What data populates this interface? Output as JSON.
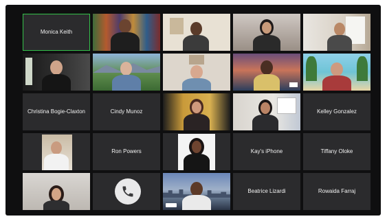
{
  "meeting": {
    "tiles": [
      {
        "label": "Monica Keith",
        "type": "name",
        "active": true
      },
      {
        "label": "",
        "type": "video",
        "scene": "mural"
      },
      {
        "label": "",
        "type": "video",
        "scene": "room-light"
      },
      {
        "label": "",
        "type": "video",
        "scene": "room-dark"
      },
      {
        "label": "",
        "type": "video",
        "scene": "window-room"
      },
      {
        "label": "",
        "type": "video",
        "scene": "dark-room"
      },
      {
        "label": "",
        "type": "video",
        "scene": "mountains"
      },
      {
        "label": "",
        "type": "video",
        "scene": "room-art"
      },
      {
        "label": "",
        "type": "video",
        "scene": "sunset"
      },
      {
        "label": "",
        "type": "video",
        "scene": "beach"
      },
      {
        "label": "Christina Bogie-Claxton",
        "type": "name"
      },
      {
        "label": "Cindy Munoz",
        "type": "name"
      },
      {
        "label": "",
        "type": "video",
        "scene": "yellow-room"
      },
      {
        "label": "",
        "type": "video",
        "scene": "office"
      },
      {
        "label": "Kelley Gonzalez",
        "type": "name"
      },
      {
        "label": "",
        "type": "video",
        "scene": "cafe"
      },
      {
        "label": "Ron Powers",
        "type": "name"
      },
      {
        "label": "",
        "type": "video",
        "scene": "white-wall"
      },
      {
        "label": "Kay's iPhone",
        "type": "name"
      },
      {
        "label": "Tiffany Oloke",
        "type": "name"
      },
      {
        "label": "",
        "type": "video",
        "scene": "grey-room"
      },
      {
        "label": "",
        "type": "phone"
      },
      {
        "label": "",
        "type": "video",
        "scene": "city"
      },
      {
        "label": "Beatrice Lizardi",
        "type": "name"
      },
      {
        "label": "Rowaida Farraj",
        "type": "name"
      }
    ]
  },
  "colors": {
    "background": "#0f0f10",
    "tile": "#2b2b2d",
    "active_border": "#33c24a",
    "name_text": "#f2f2f2"
  },
  "icons": {
    "phone": "phone-icon"
  }
}
